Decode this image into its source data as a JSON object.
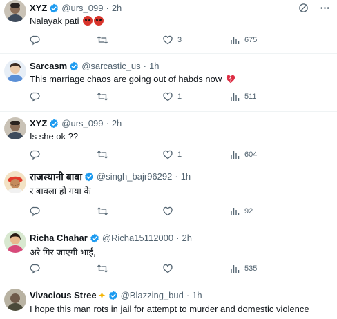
{
  "icons": {
    "grok": "grok-icon",
    "more": "more-icon",
    "reply": "reply-icon",
    "repost": "repost-icon",
    "like": "like-icon",
    "views": "views-icon",
    "verified": "verified-badge-icon"
  },
  "colors": {
    "verified": "#1d9bf0",
    "muted": "#536471",
    "text": "#0f1419"
  },
  "tweets": [
    {
      "name": "XYZ",
      "handle": "@urs_099",
      "dot": "·",
      "time": "2h",
      "text": "Nalayak pati",
      "reply_count": "",
      "repost_count": "",
      "like_count": "3",
      "view_count": "675",
      "emoji": "angry-face-emoji x2"
    },
    {
      "name": "Sarcasm",
      "handle": "@sarcastic_us",
      "dot": "·",
      "time": "1h",
      "text": "This marriage chaos are going out of habds now",
      "reply_count": "",
      "repost_count": "",
      "like_count": "1",
      "view_count": "511",
      "emoji": "broken-heart-emoji"
    },
    {
      "name": "XYZ",
      "handle": "@urs_099",
      "dot": "·",
      "time": "2h",
      "text": "Is she ok ??",
      "reply_count": "",
      "repost_count": "",
      "like_count": "1",
      "view_count": "604"
    },
    {
      "name": "राजस्थानी बाबा",
      "handle": "@singh_bajr96292",
      "dot": "·",
      "time": "1h",
      "text": "र बावला हो गया के",
      "reply_count": "",
      "repost_count": "",
      "like_count": "",
      "view_count": "92"
    },
    {
      "name": "Richa Chahar",
      "handle": "@Richa15112000",
      "dot": "·",
      "time": "2h",
      "text": "अरे गिर जाएगी भाई,",
      "reply_count": "",
      "repost_count": "",
      "like_count": "",
      "view_count": "535"
    },
    {
      "name": "Vivacious Stree",
      "handle": "@Blazzing_bud",
      "dot": "·",
      "time": "1h",
      "text": "I hope this man rots in jail for attempt to murder and domestic violence",
      "emoji": "sparkles-emoji"
    }
  ]
}
